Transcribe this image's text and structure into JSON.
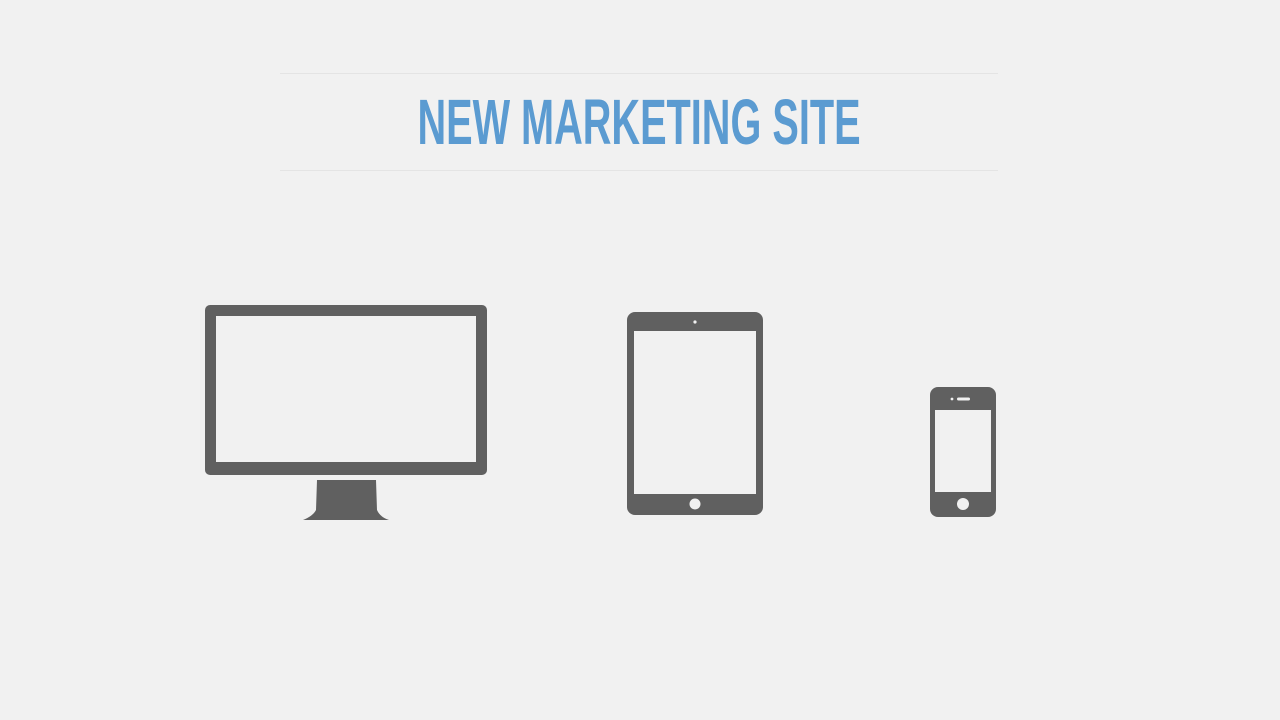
{
  "page": {
    "title": "NEW MARKETING SITE"
  },
  "colors": {
    "background": "#f1f1f1",
    "title": "#5b9bd1",
    "device": "#606060"
  },
  "devices": [
    {
      "name": "monitor",
      "icon": "desktop-monitor-icon"
    },
    {
      "name": "tablet",
      "icon": "tablet-icon"
    },
    {
      "name": "phone",
      "icon": "smartphone-icon"
    }
  ]
}
